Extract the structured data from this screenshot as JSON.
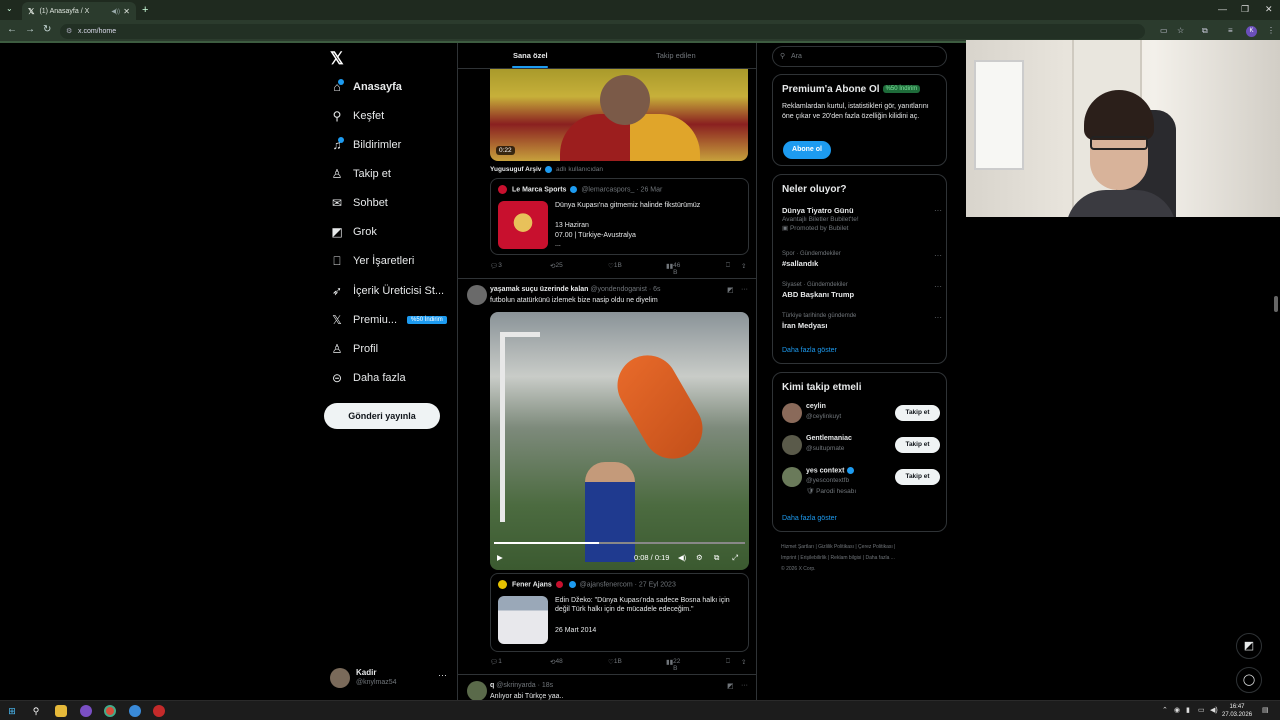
{
  "browser": {
    "tab_title": "(1) Anasayfa / X",
    "url": "x.com/home",
    "profile_initial": "K"
  },
  "nav": {
    "items": [
      {
        "label": "Anasayfa",
        "icon": "home-icon"
      },
      {
        "label": "Keşfet",
        "icon": "search-icon"
      },
      {
        "label": "Bildirimler",
        "icon": "bell-icon"
      },
      {
        "label": "Takip et",
        "icon": "person-plus-icon"
      },
      {
        "label": "Sohbet",
        "icon": "envelope-icon"
      },
      {
        "label": "Grok",
        "icon": "grok-icon"
      },
      {
        "label": "Yer İşaretleri",
        "icon": "bookmark-icon"
      },
      {
        "label": "İçerik Üreticisi St...",
        "icon": "rocket-icon"
      },
      {
        "label": "Premiu...",
        "icon": "x-icon",
        "badge": "%50 İndirim"
      },
      {
        "label": "Profil",
        "icon": "person-icon"
      },
      {
        "label": "Daha fazla",
        "icon": "more-circle-icon"
      }
    ],
    "post_button": "Gönderi yayınla",
    "account": {
      "name": "Kadir",
      "handle": "@knylmaz54"
    }
  },
  "feed": {
    "tabs": [
      "Sana özel",
      "Takip edilen"
    ],
    "post1": {
      "duration": "0:22",
      "source_name": "Yugusuguf Arşiv",
      "source_suffix": "adlı kullanıcıdan",
      "quote": {
        "author": "Le Marca Sports",
        "handle": "@lemarcaspors_ · 26 Mar",
        "line1": "Dünya Kupası'na gitmemiz halinde fikstürümüz",
        "line2": "13 Haziran",
        "line3": "07.00 | Türkiye-Avustralya",
        "line4": "..."
      },
      "stats": {
        "replies": "3",
        "reposts": "25",
        "likes": "1B",
        "views": "46 B"
      }
    },
    "post2": {
      "author": "yaşamak suçu üzerinde kalan",
      "handle": "@yondendoganist · 6s",
      "text": "futbolun atatürkünü izlemek bize nasip oldu ne diyelim",
      "video_time": "0:08 / 0:19",
      "progress": 0.42,
      "quote": {
        "author": "Fener Ajans",
        "handle": "@ajansfenercom · 27 Eyl 2023",
        "text1": "Edin Džeko: \"Dünya Kupası'nda sadece Bosna halkı için",
        "text2": "değil Türk halkı için de mücadele edeceğim.\"",
        "date": "26 Mart 2014"
      },
      "stats": {
        "replies": "1",
        "reposts": "48",
        "likes": "1B",
        "views": "22 B"
      }
    },
    "post3": {
      "author": "q",
      "handle": "@skrinyarda · 18s",
      "text": "Anlıyor abi Türkçe yaa.."
    }
  },
  "right": {
    "search_placeholder": "Ara",
    "premium": {
      "title": "Premium'a Abone Ol",
      "badge": "%50 İndirim",
      "desc": "Reklamlardan kurtul, istatistikleri gör, yanıtlarını öne çıkar ve 20'den fazla özelliğin kilidini aç.",
      "button": "Abone ol"
    },
    "trends": {
      "title": "Neler oluyor?",
      "items": [
        {
          "cat": "",
          "name": "Dünya Tiyatro Günü",
          "meta": "Avantajlı Biletler Bubilet'te!",
          "promo": "Promoted by Bubilet"
        },
        {
          "cat": "Spor · Gündemdekiler",
          "name": "#sallandık",
          "meta": "",
          "promo": ""
        },
        {
          "cat": "Siyaset · Gündemdekiler",
          "name": "ABD Başkanı Trump",
          "meta": "",
          "promo": ""
        },
        {
          "cat": "Türkiye tarihinde gündemde",
          "name": "İran Medyası",
          "meta": "",
          "promo": ""
        }
      ],
      "more": "Daha fazla göster"
    },
    "who": {
      "title": "Kimi takip etmeli",
      "items": [
        {
          "name": "ceylin",
          "handle": "@ceylinkuyt",
          "extra": "",
          "button": "Takip et"
        },
        {
          "name": "Gentlemaniac",
          "handle": "@sultupmate",
          "extra": "",
          "button": "Takip et"
        },
        {
          "name": "yes context",
          "handle": "@yescontextfb",
          "extra": "Parodi hesabı",
          "button": "Takip et"
        }
      ],
      "more": "Daha fazla göster"
    },
    "footer": {
      "line1": "Hizmet Şartları  |  Gizlilik Politikası  |  Çerez Politikası  |",
      "line2": "Imprint  |  Erişilebilirlik  |  Reklam bilgisi  |  Daha fazla ...",
      "line3": "© 2026 X Corp."
    }
  },
  "taskbar": {
    "time": "16:47",
    "date": "27.03.2026"
  }
}
